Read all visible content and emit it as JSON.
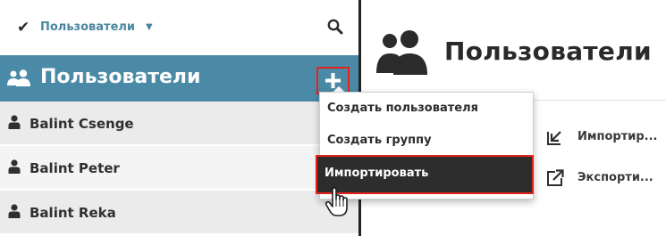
{
  "left_panel": {
    "filter": {
      "label": "Пользователи",
      "check_icon": "checkmark-icon",
      "caret_icon": "caret-down-icon"
    },
    "search_icon": "search-icon",
    "group_header": {
      "title": "Пользователи",
      "icon": "users-group-icon"
    },
    "add_button": {
      "icon": "plus-icon"
    },
    "users": [
      {
        "name": "Balint Csenge",
        "icon": "user-icon"
      },
      {
        "name": "Balint Peter",
        "icon": "user-icon"
      },
      {
        "name": "Balint Reka",
        "icon": "user-icon"
      }
    ]
  },
  "right_panel": {
    "title": "Пользователи",
    "title_icon": "users-group-icon",
    "actions": [
      {
        "label": "Импортир...",
        "icon": "import-icon"
      },
      {
        "label": "Экспорти...",
        "icon": "export-icon"
      }
    ]
  },
  "add_menu": {
    "items": [
      {
        "label": "Создать пользователя"
      },
      {
        "label": "Создать группу"
      },
      {
        "label": "Импортировать"
      }
    ],
    "highlighted_index": 2
  },
  "colors": {
    "accent": "#4a8aa6",
    "highlight_border": "#e3231b",
    "menu_active_bg": "#2d2d2d",
    "filter_text": "#4a86a0"
  }
}
